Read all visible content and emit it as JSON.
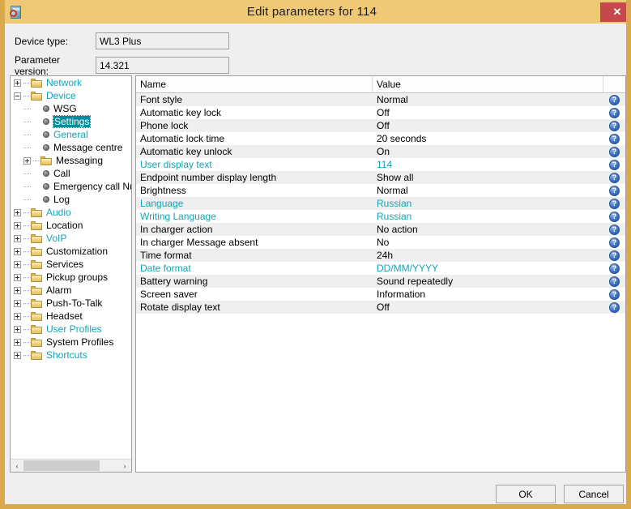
{
  "window": {
    "title": "Edit parameters for 114",
    "app_icon": "phone-config-icon",
    "close_label": "✕"
  },
  "header": {
    "device_type_label": "Device type:",
    "device_type_value": "WL3 Plus",
    "parameter_version_label": "Parameter version:",
    "parameter_version_value": "14.321"
  },
  "colors": {
    "titlebar": "#efc976",
    "border": "#d9a94c",
    "close_button": "#c6484d",
    "modified_text": "#14a3b4",
    "selection": "#008c9e",
    "row_alt": "#efefef",
    "help_icon": "#3f72c4"
  },
  "tree": {
    "nodes": [
      {
        "label": "Network",
        "level": 0,
        "type": "folder",
        "expander": "plus",
        "modified": true,
        "selected": false
      },
      {
        "label": "Device",
        "level": 0,
        "type": "folder",
        "expander": "minus",
        "modified": true,
        "selected": false
      },
      {
        "label": "WSG",
        "level": 1,
        "type": "leaf",
        "expander": "none",
        "modified": false,
        "selected": false
      },
      {
        "label": "Settings",
        "level": 1,
        "type": "leaf",
        "expander": "none",
        "modified": true,
        "selected": true
      },
      {
        "label": "General",
        "level": 1,
        "type": "leaf",
        "expander": "none",
        "modified": true,
        "selected": false
      },
      {
        "label": "Message centre",
        "level": 1,
        "type": "leaf",
        "expander": "none",
        "modified": false,
        "selected": false
      },
      {
        "label": "Messaging",
        "level": 1,
        "type": "folder",
        "expander": "plus",
        "modified": false,
        "selected": false
      },
      {
        "label": "Call",
        "level": 1,
        "type": "leaf",
        "expander": "none",
        "modified": false,
        "selected": false
      },
      {
        "label": "Emergency call Number",
        "level": 1,
        "type": "leaf",
        "expander": "none",
        "modified": false,
        "selected": false
      },
      {
        "label": "Log",
        "level": 1,
        "type": "leaf",
        "expander": "none",
        "modified": false,
        "selected": false
      },
      {
        "label": "Audio",
        "level": 0,
        "type": "folder",
        "expander": "plus",
        "modified": true,
        "selected": false
      },
      {
        "label": "Location",
        "level": 0,
        "type": "folder",
        "expander": "plus",
        "modified": false,
        "selected": false
      },
      {
        "label": "VoIP",
        "level": 0,
        "type": "folder",
        "expander": "plus",
        "modified": true,
        "selected": false
      },
      {
        "label": "Customization",
        "level": 0,
        "type": "folder",
        "expander": "plus",
        "modified": false,
        "selected": false
      },
      {
        "label": "Services",
        "level": 0,
        "type": "folder",
        "expander": "plus",
        "modified": false,
        "selected": false
      },
      {
        "label": "Pickup groups",
        "level": 0,
        "type": "folder",
        "expander": "plus",
        "modified": false,
        "selected": false
      },
      {
        "label": "Alarm",
        "level": 0,
        "type": "folder",
        "expander": "plus",
        "modified": false,
        "selected": false
      },
      {
        "label": "Push-To-Talk",
        "level": 0,
        "type": "folder",
        "expander": "plus",
        "modified": false,
        "selected": false
      },
      {
        "label": "Headset",
        "level": 0,
        "type": "folder",
        "expander": "plus",
        "modified": false,
        "selected": false
      },
      {
        "label": "User Profiles",
        "level": 0,
        "type": "folder",
        "expander": "plus",
        "modified": true,
        "selected": false
      },
      {
        "label": "System Profiles",
        "level": 0,
        "type": "folder",
        "expander": "plus",
        "modified": false,
        "selected": false
      },
      {
        "label": "Shortcuts",
        "level": 0,
        "type": "folder",
        "expander": "plus",
        "modified": true,
        "selected": false
      }
    ],
    "scrollbar": {
      "left_arrow": "‹",
      "right_arrow": "›"
    }
  },
  "table": {
    "columns": [
      "Name",
      "Value",
      ""
    ],
    "help_glyph": "?",
    "rows": [
      {
        "name": "Font style",
        "value": "Normal",
        "modified": false
      },
      {
        "name": "Automatic key lock",
        "value": "Off",
        "modified": false
      },
      {
        "name": "Phone lock",
        "value": "Off",
        "modified": false
      },
      {
        "name": "Automatic lock time",
        "value": "20 seconds",
        "modified": false
      },
      {
        "name": "Automatic key unlock",
        "value": "On",
        "modified": false
      },
      {
        "name": "User display text",
        "value": "114",
        "modified": true
      },
      {
        "name": "Endpoint number display length",
        "value": "Show all",
        "modified": false
      },
      {
        "name": "Brightness",
        "value": "Normal",
        "modified": false
      },
      {
        "name": "Language",
        "value": "Russian",
        "modified": true
      },
      {
        "name": "Writing Language",
        "value": "Russian",
        "modified": true
      },
      {
        "name": "In charger action",
        "value": "No action",
        "modified": false
      },
      {
        "name": "In charger Message absent",
        "value": "No",
        "modified": false
      },
      {
        "name": "Time format",
        "value": "24h",
        "modified": false
      },
      {
        "name": "Date format",
        "value": "DD/MM/YYYY",
        "modified": true
      },
      {
        "name": "Battery warning",
        "value": "Sound repeatedly",
        "modified": false
      },
      {
        "name": "Screen saver",
        "value": "Information",
        "modified": false
      },
      {
        "name": "Rotate display text",
        "value": "Off",
        "modified": false
      }
    ]
  },
  "footer": {
    "ok_label": "OK",
    "cancel_label": "Cancel"
  }
}
